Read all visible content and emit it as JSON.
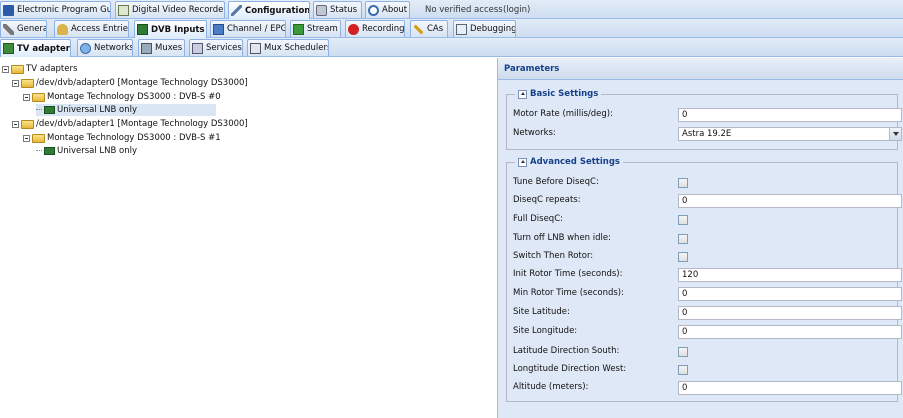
{
  "tabs_top": [
    {
      "label": "Electronic Program Guide",
      "icon": "epg-icon",
      "active": false
    },
    {
      "label": "Digital Video Recorder",
      "icon": "dvr-icon",
      "active": false
    },
    {
      "label": "Configuration",
      "icon": "wrench-icon",
      "active": true
    },
    {
      "label": "Status",
      "icon": "status-icon",
      "active": false
    },
    {
      "label": "About",
      "icon": "about-icon",
      "active": false
    }
  ],
  "access_text": "No verified access",
  "login_text": "(login)",
  "tabs_config": [
    {
      "label": "General",
      "icon": "general-icon",
      "active": false
    },
    {
      "label": "Access Entries",
      "icon": "access-icon",
      "active": false
    },
    {
      "label": "DVB Inputs",
      "icon": "dvb-icon",
      "active": true
    },
    {
      "label": "Channel / EPG",
      "icon": "channel-epg-icon",
      "active": false
    },
    {
      "label": "Stream",
      "icon": "stream-icon",
      "active": false
    },
    {
      "label": "Recording",
      "icon": "rec-icon",
      "active": false
    },
    {
      "label": "CAs",
      "icon": "key-icon",
      "active": false
    },
    {
      "label": "Debugging",
      "icon": "debug-icon",
      "active": false
    }
  ],
  "tabs_dvb": [
    {
      "label": "TV adapters",
      "icon": "tv-adapter-icon",
      "active": true
    },
    {
      "label": "Networks",
      "icon": "network-icon",
      "active": false
    },
    {
      "label": "Muxes",
      "icon": "mux-icon",
      "active": false
    },
    {
      "label": "Services",
      "icon": "services-icon",
      "active": false
    },
    {
      "label": "Mux Schedulers",
      "icon": "scheduler-icon",
      "active": false
    }
  ],
  "tree": {
    "root": "TV adapters",
    "adapter0": "/dev/dvb/adapter0 [Montage Technology DS3000]",
    "frontend0": "Montage Technology DS3000 : DVB-S #0",
    "lnb0": "Universal LNB only",
    "adapter1": "/dev/dvb/adapter1 [Montage Technology DS3000]",
    "frontend1": "Montage Technology DS3000 : DVB-S #1",
    "lnb1": "Universal LNB only"
  },
  "params": {
    "title": "Parameters",
    "basic": {
      "title": "Basic Settings",
      "motor_rate_label": "Motor Rate (millis/deg):",
      "motor_rate_value": "0",
      "networks_label": "Networks:",
      "networks_value": "Astra 19.2E"
    },
    "advanced": {
      "title": "Advanced Settings",
      "tune_before_label": "Tune Before DiseqC:",
      "diseqc_repeats_label": "DiseqC repeats:",
      "diseqc_repeats_value": "0",
      "full_diseqc_label": "Full DiseqC:",
      "turn_off_lnb_label": "Turn off LNB when idle:",
      "switch_then_rotor_label": "Switch Then Rotor:",
      "init_rotor_label": "Init Rotor Time (seconds):",
      "init_rotor_value": "120",
      "min_rotor_label": "Min Rotor Time (seconds):",
      "min_rotor_value": "0",
      "site_lat_label": "Site Latitude:",
      "site_lat_value": "0",
      "site_lon_label": "Site Longitude:",
      "site_lon_value": "0",
      "lat_south_label": "Latitude Direction South:",
      "lon_west_label": "Longtitude Direction West:",
      "altitude_label": "Altitude (meters):",
      "altitude_value": "0"
    }
  }
}
